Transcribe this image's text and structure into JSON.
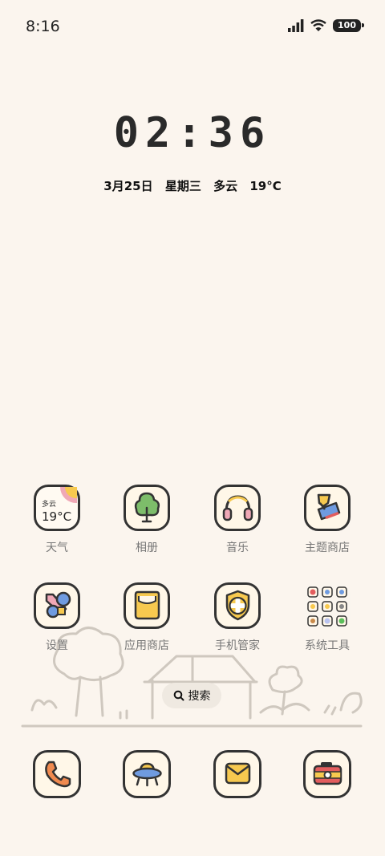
{
  "status": {
    "time": "8:16",
    "battery": "100"
  },
  "clock": {
    "time": "02:36"
  },
  "date": {
    "date": "3月25日",
    "weekday": "星期三",
    "weather": "多云",
    "temp": "19°C"
  },
  "weather_widget": {
    "condition": "多云",
    "temp": "19°C"
  },
  "apps": [
    {
      "label": "天气",
      "icon": "weather-icon"
    },
    {
      "label": "相册",
      "icon": "gallery-tree-icon"
    },
    {
      "label": "音乐",
      "icon": "headphones-icon"
    },
    {
      "label": "主题商店",
      "icon": "paint-roller-icon"
    },
    {
      "label": "设置",
      "icon": "wrench-icon"
    },
    {
      "label": "应用商店",
      "icon": "bag-icon"
    },
    {
      "label": "手机管家",
      "icon": "shield-plus-icon"
    },
    {
      "label": "系统工具",
      "icon": "folder-icon"
    }
  ],
  "search": {
    "label": "搜索"
  },
  "dock": [
    {
      "icon": "phone-icon"
    },
    {
      "icon": "ufo-icon"
    },
    {
      "icon": "message-icon"
    },
    {
      "icon": "camera-icon"
    }
  ]
}
